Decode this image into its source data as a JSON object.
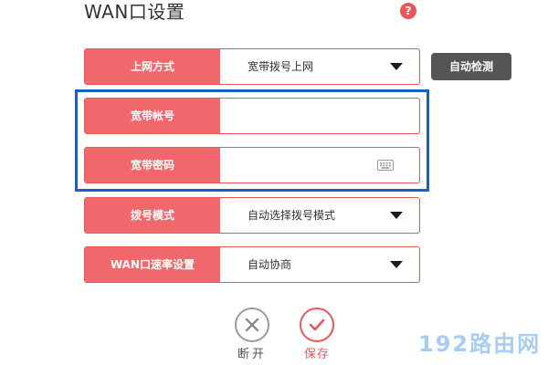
{
  "page": {
    "title": "WAN口设置",
    "help_icon_text": "?"
  },
  "form": {
    "connection_type": {
      "label": "上网方式",
      "value": "宽带拨号上网",
      "detect_button": "自动检测"
    },
    "account": {
      "label": "宽带帐号",
      "value": ""
    },
    "password": {
      "label": "宽带密码",
      "value": ""
    },
    "dial_mode": {
      "label": "拨号模式",
      "value": "自动选择拨号模式"
    },
    "wan_speed": {
      "label": "WAN口速率设置",
      "value": "自动协商"
    }
  },
  "actions": {
    "disconnect": "断开",
    "save": "保存"
  },
  "watermark": "192路由网",
  "colors": {
    "accent": "#f0686b",
    "border": "#e8575a",
    "highlight": "#1a5fc8",
    "button_dark": "#555555",
    "watermark": "#a9cdf2"
  }
}
